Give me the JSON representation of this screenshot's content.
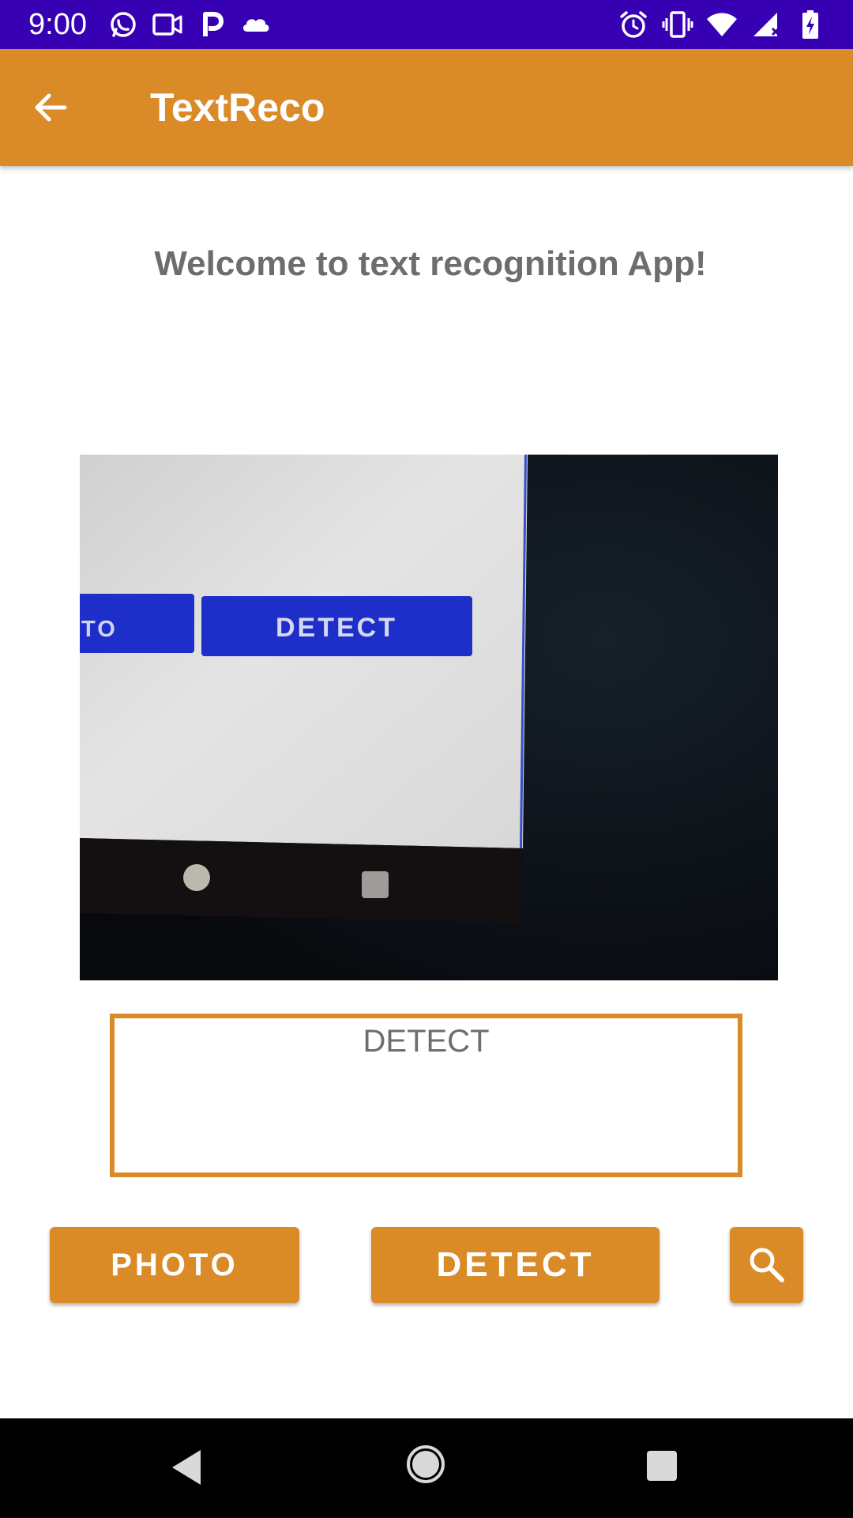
{
  "status_bar": {
    "time": "9:00",
    "left_icons": [
      "whatsapp-icon",
      "video-camera-icon",
      "parking-icon",
      "cloud-icon"
    ],
    "right_icons": [
      "alarm-icon",
      "vibrate-icon",
      "wifi-icon",
      "signal-icon",
      "battery-charging-icon"
    ],
    "background": "#3700b3"
  },
  "app_bar": {
    "title": "TextReco",
    "back_icon": "arrow-back-icon",
    "background": "#da8a27"
  },
  "main": {
    "welcome_text": "Welcome to text recognition App!",
    "photo": {
      "partial_button_label": "TO",
      "button_label": "DETECT"
    },
    "result_text": "DETECT"
  },
  "buttons": {
    "photo_label": "PHOTO",
    "detect_label": "DETECT",
    "search_icon": "search-icon"
  },
  "nav_bar": {
    "icons": [
      "nav-back-icon",
      "nav-home-icon",
      "nav-recents-icon"
    ]
  },
  "colors": {
    "accent": "#da8a27",
    "status_bar": "#3700b3",
    "text_gray": "#6d6d6d"
  }
}
